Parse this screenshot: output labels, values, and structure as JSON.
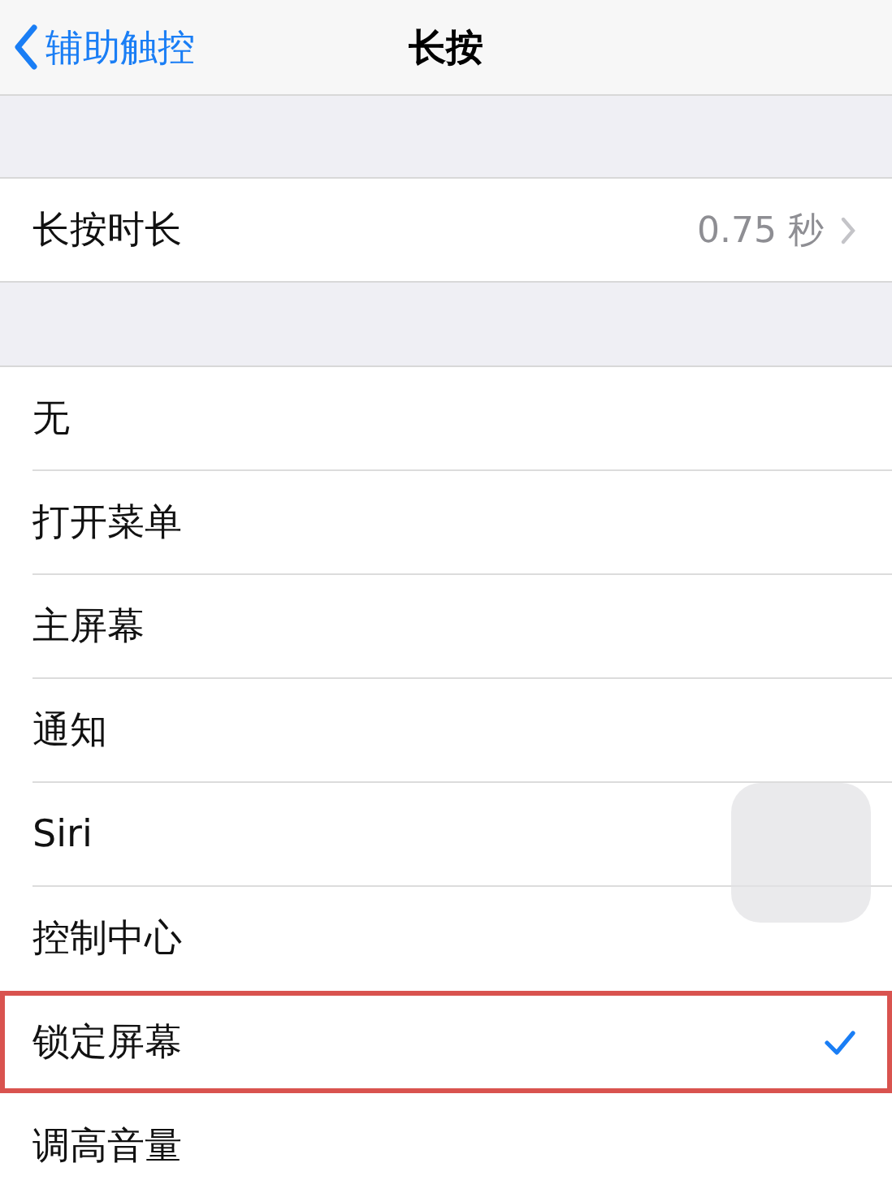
{
  "nav": {
    "back": "辅助触控",
    "title": "长按"
  },
  "duration": {
    "label": "长按时长",
    "value": "0.75 秒"
  },
  "actions": [
    {
      "label": "无",
      "selected": false,
      "highlighted": false
    },
    {
      "label": "打开菜单",
      "selected": false,
      "highlighted": false
    },
    {
      "label": "主屏幕",
      "selected": false,
      "highlighted": false
    },
    {
      "label": "通知",
      "selected": false,
      "highlighted": false
    },
    {
      "label": "Siri",
      "selected": false,
      "highlighted": false
    },
    {
      "label": "控制中心",
      "selected": false,
      "highlighted": false
    },
    {
      "label": "锁定屏幕",
      "selected": true,
      "highlighted": true
    },
    {
      "label": "调高音量",
      "selected": false,
      "highlighted": false
    }
  ]
}
